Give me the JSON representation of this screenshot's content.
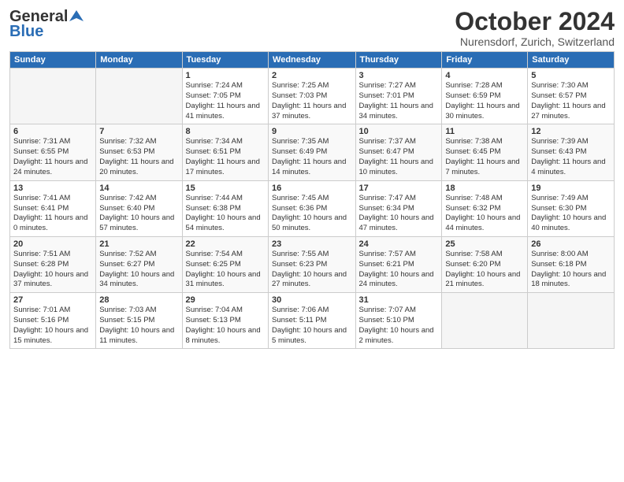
{
  "header": {
    "logo_general": "General",
    "logo_blue": "Blue",
    "month": "October 2024",
    "location": "Nurensdorf, Zurich, Switzerland"
  },
  "weekdays": [
    "Sunday",
    "Monday",
    "Tuesday",
    "Wednesday",
    "Thursday",
    "Friday",
    "Saturday"
  ],
  "weeks": [
    [
      {
        "day": "",
        "empty": true
      },
      {
        "day": "",
        "empty": true
      },
      {
        "day": "1",
        "sunrise": "Sunrise: 7:24 AM",
        "sunset": "Sunset: 7:05 PM",
        "daylight": "Daylight: 11 hours and 41 minutes."
      },
      {
        "day": "2",
        "sunrise": "Sunrise: 7:25 AM",
        "sunset": "Sunset: 7:03 PM",
        "daylight": "Daylight: 11 hours and 37 minutes."
      },
      {
        "day": "3",
        "sunrise": "Sunrise: 7:27 AM",
        "sunset": "Sunset: 7:01 PM",
        "daylight": "Daylight: 11 hours and 34 minutes."
      },
      {
        "day": "4",
        "sunrise": "Sunrise: 7:28 AM",
        "sunset": "Sunset: 6:59 PM",
        "daylight": "Daylight: 11 hours and 30 minutes."
      },
      {
        "day": "5",
        "sunrise": "Sunrise: 7:30 AM",
        "sunset": "Sunset: 6:57 PM",
        "daylight": "Daylight: 11 hours and 27 minutes."
      }
    ],
    [
      {
        "day": "6",
        "sunrise": "Sunrise: 7:31 AM",
        "sunset": "Sunset: 6:55 PM",
        "daylight": "Daylight: 11 hours and 24 minutes."
      },
      {
        "day": "7",
        "sunrise": "Sunrise: 7:32 AM",
        "sunset": "Sunset: 6:53 PM",
        "daylight": "Daylight: 11 hours and 20 minutes."
      },
      {
        "day": "8",
        "sunrise": "Sunrise: 7:34 AM",
        "sunset": "Sunset: 6:51 PM",
        "daylight": "Daylight: 11 hours and 17 minutes."
      },
      {
        "day": "9",
        "sunrise": "Sunrise: 7:35 AM",
        "sunset": "Sunset: 6:49 PM",
        "daylight": "Daylight: 11 hours and 14 minutes."
      },
      {
        "day": "10",
        "sunrise": "Sunrise: 7:37 AM",
        "sunset": "Sunset: 6:47 PM",
        "daylight": "Daylight: 11 hours and 10 minutes."
      },
      {
        "day": "11",
        "sunrise": "Sunrise: 7:38 AM",
        "sunset": "Sunset: 6:45 PM",
        "daylight": "Daylight: 11 hours and 7 minutes."
      },
      {
        "day": "12",
        "sunrise": "Sunrise: 7:39 AM",
        "sunset": "Sunset: 6:43 PM",
        "daylight": "Daylight: 11 hours and 4 minutes."
      }
    ],
    [
      {
        "day": "13",
        "sunrise": "Sunrise: 7:41 AM",
        "sunset": "Sunset: 6:41 PM",
        "daylight": "Daylight: 11 hours and 0 minutes."
      },
      {
        "day": "14",
        "sunrise": "Sunrise: 7:42 AM",
        "sunset": "Sunset: 6:40 PM",
        "daylight": "Daylight: 10 hours and 57 minutes."
      },
      {
        "day": "15",
        "sunrise": "Sunrise: 7:44 AM",
        "sunset": "Sunset: 6:38 PM",
        "daylight": "Daylight: 10 hours and 54 minutes."
      },
      {
        "day": "16",
        "sunrise": "Sunrise: 7:45 AM",
        "sunset": "Sunset: 6:36 PM",
        "daylight": "Daylight: 10 hours and 50 minutes."
      },
      {
        "day": "17",
        "sunrise": "Sunrise: 7:47 AM",
        "sunset": "Sunset: 6:34 PM",
        "daylight": "Daylight: 10 hours and 47 minutes."
      },
      {
        "day": "18",
        "sunrise": "Sunrise: 7:48 AM",
        "sunset": "Sunset: 6:32 PM",
        "daylight": "Daylight: 10 hours and 44 minutes."
      },
      {
        "day": "19",
        "sunrise": "Sunrise: 7:49 AM",
        "sunset": "Sunset: 6:30 PM",
        "daylight": "Daylight: 10 hours and 40 minutes."
      }
    ],
    [
      {
        "day": "20",
        "sunrise": "Sunrise: 7:51 AM",
        "sunset": "Sunset: 6:28 PM",
        "daylight": "Daylight: 10 hours and 37 minutes."
      },
      {
        "day": "21",
        "sunrise": "Sunrise: 7:52 AM",
        "sunset": "Sunset: 6:27 PM",
        "daylight": "Daylight: 10 hours and 34 minutes."
      },
      {
        "day": "22",
        "sunrise": "Sunrise: 7:54 AM",
        "sunset": "Sunset: 6:25 PM",
        "daylight": "Daylight: 10 hours and 31 minutes."
      },
      {
        "day": "23",
        "sunrise": "Sunrise: 7:55 AM",
        "sunset": "Sunset: 6:23 PM",
        "daylight": "Daylight: 10 hours and 27 minutes."
      },
      {
        "day": "24",
        "sunrise": "Sunrise: 7:57 AM",
        "sunset": "Sunset: 6:21 PM",
        "daylight": "Daylight: 10 hours and 24 minutes."
      },
      {
        "day": "25",
        "sunrise": "Sunrise: 7:58 AM",
        "sunset": "Sunset: 6:20 PM",
        "daylight": "Daylight: 10 hours and 21 minutes."
      },
      {
        "day": "26",
        "sunrise": "Sunrise: 8:00 AM",
        "sunset": "Sunset: 6:18 PM",
        "daylight": "Daylight: 10 hours and 18 minutes."
      }
    ],
    [
      {
        "day": "27",
        "sunrise": "Sunrise: 7:01 AM",
        "sunset": "Sunset: 5:16 PM",
        "daylight": "Daylight: 10 hours and 15 minutes."
      },
      {
        "day": "28",
        "sunrise": "Sunrise: 7:03 AM",
        "sunset": "Sunset: 5:15 PM",
        "daylight": "Daylight: 10 hours and 11 minutes."
      },
      {
        "day": "29",
        "sunrise": "Sunrise: 7:04 AM",
        "sunset": "Sunset: 5:13 PM",
        "daylight": "Daylight: 10 hours and 8 minutes."
      },
      {
        "day": "30",
        "sunrise": "Sunrise: 7:06 AM",
        "sunset": "Sunset: 5:11 PM",
        "daylight": "Daylight: 10 hours and 5 minutes."
      },
      {
        "day": "31",
        "sunrise": "Sunrise: 7:07 AM",
        "sunset": "Sunset: 5:10 PM",
        "daylight": "Daylight: 10 hours and 2 minutes."
      },
      {
        "day": "",
        "empty": true
      },
      {
        "day": "",
        "empty": true
      }
    ]
  ]
}
